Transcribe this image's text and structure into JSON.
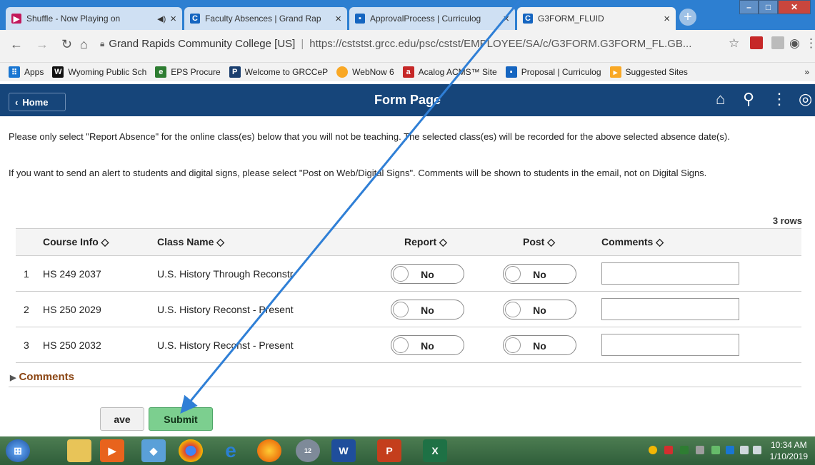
{
  "browser": {
    "tabs": [
      {
        "label": "Shuffle - Now Playing on",
        "icon_color": "#c2185b"
      },
      {
        "label": "Faculty Absences | Grand Rap",
        "icon_color": "#1565c0"
      },
      {
        "label": "ApprovalProcess | Curriculog",
        "icon_color": "#1565c0"
      },
      {
        "label": "G3FORM_FLUID",
        "icon_color": "#1565c0"
      }
    ],
    "site_name": "Grand Rapids Community College [US]",
    "url": "https://cststst.grcc.edu/psc/cstst/EMPLOYEE/SA/c/G3FORM.G3FORM_FL.GB...",
    "bookmarks": [
      {
        "label": "Apps",
        "icon_color": "#1976d2"
      },
      {
        "label": "Wyoming Public Sch",
        "icon_color": "#111111"
      },
      {
        "label": "EPS Procure",
        "icon_color": "#2e7d32"
      },
      {
        "label": "Welcome to GRCCeP",
        "icon_color": "#1a3e6e"
      },
      {
        "label": "WebNow 6",
        "icon_color": "#f9a825"
      },
      {
        "label": "Acalog ACMS™ Site",
        "icon_color": "#c62828"
      },
      {
        "label": "Proposal | Curriculog",
        "icon_color": "#1565c0"
      },
      {
        "label": "Suggested Sites",
        "icon_color": "#f9a825"
      }
    ],
    "more_chevron": "»"
  },
  "page": {
    "home_label": "Home",
    "title": "Form Page",
    "instruction1": "Please only select \"Report Absence\" for the online class(es) below that you will not be teaching. The selected class(es) will be recorded for the above selected absence date(s).",
    "instruction2": "If you want to send an alert to students and digital signs, please select \"Post on Web/Digital Signs\". Comments will be shown to students in the email, not on Digital Signs.",
    "rows_count": "3 rows",
    "columns": [
      "Course Info ◇",
      "Class Name ◇",
      "Report ◇",
      "Post ◇",
      "Comments ◇"
    ],
    "rows": [
      {
        "num": "1",
        "course": "HS  249 2037",
        "class_name": "U.S. History Through Reconstr",
        "report": "No",
        "post": "No",
        "comment": ""
      },
      {
        "num": "2",
        "course": "HS  250 2029",
        "class_name": "U.S. History Reconst - Present",
        "report": "No",
        "post": "No",
        "comment": ""
      },
      {
        "num": "3",
        "course": "HS  250 2032",
        "class_name": "U.S. History Reconst - Present",
        "report": "No",
        "post": "No",
        "comment": ""
      }
    ],
    "comments_section": "Comments",
    "save_label": "ave",
    "submit_label": "Submit"
  },
  "taskbar": {
    "time": "10:34 AM",
    "date": "1/10/2019",
    "badge": "12"
  },
  "colors": {
    "header_bg": "#16457a",
    "submit_bg": "#7ccf8f",
    "arrow": "#2f7fd6"
  }
}
